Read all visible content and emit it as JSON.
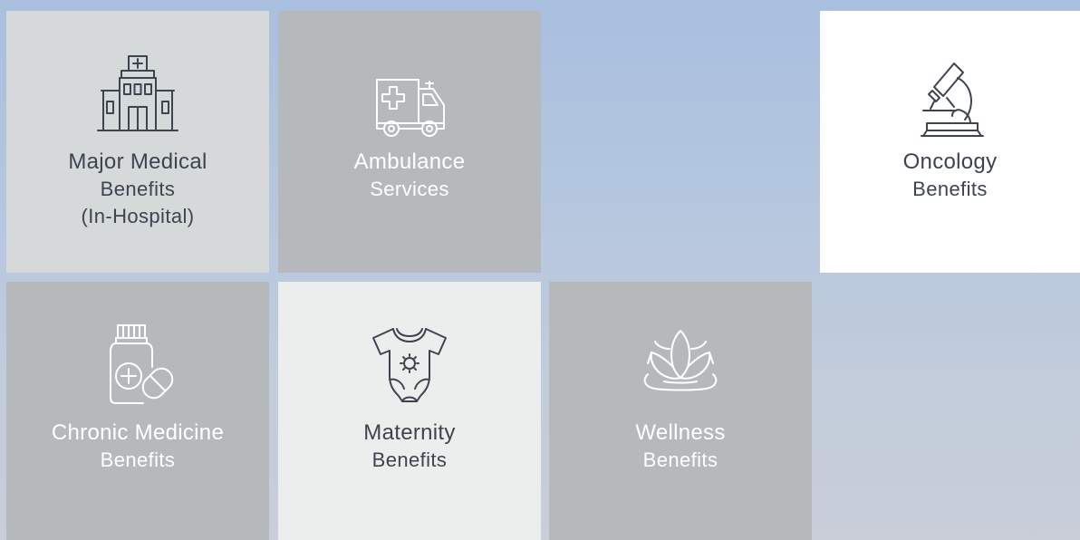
{
  "tiles": [
    {
      "key": "major-medical",
      "title": "Major Medical",
      "subtitle": "Benefits",
      "subtitle2": "(In-Hospital)",
      "icon": "hospital-icon"
    },
    {
      "key": "ambulance",
      "title": "Ambulance",
      "subtitle": "Services",
      "icon": "ambulance-icon"
    },
    {
      "key": "oncology",
      "title": "Oncology",
      "subtitle": "Benefits",
      "icon": "microscope-icon"
    },
    {
      "key": "chronic-medicine",
      "title": "Chronic Medicine",
      "subtitle": "Benefits",
      "icon": "medicine-bottle-icon"
    },
    {
      "key": "maternity",
      "title": "Maternity",
      "subtitle": "Benefits",
      "icon": "baby-onesie-icon"
    },
    {
      "key": "wellness",
      "title": "Wellness",
      "subtitle": "Benefits",
      "icon": "lotus-icon"
    }
  ],
  "colors": {
    "tile_light": "#d5d9da",
    "tile_grey": "#b5b9bc",
    "tile_white": "#ffffff",
    "tile_pale": "#eceeee",
    "text_dark": "#3d4450",
    "text_light": "#ffffff"
  }
}
